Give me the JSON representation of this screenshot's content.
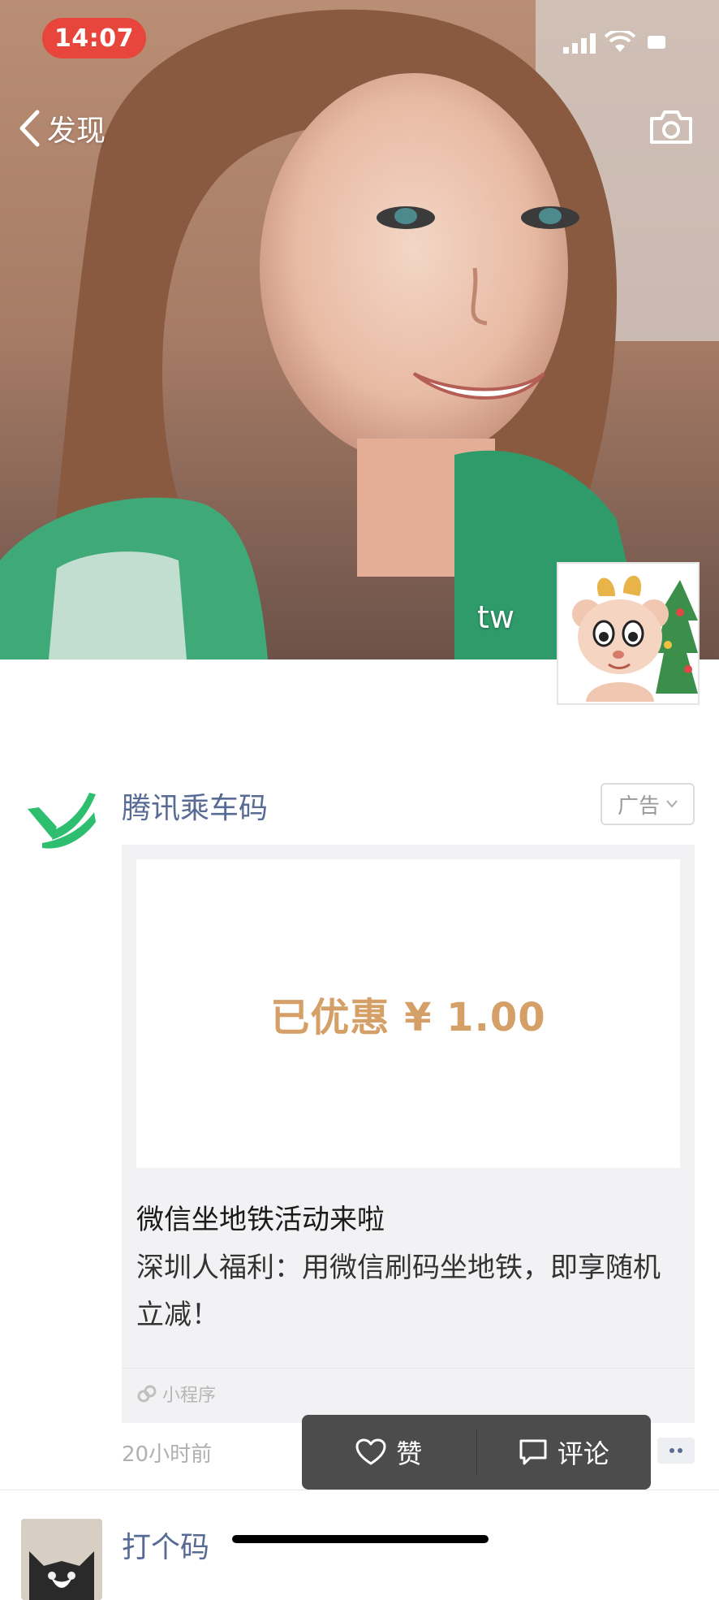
{
  "status_bar": {
    "time": "14:07",
    "time_pill_color": "#e8453c",
    "icons": [
      "signal-icon",
      "wifi-icon",
      "battery-icon"
    ]
  },
  "nav": {
    "back_label": "发现",
    "back_icon": "chevron-left-icon",
    "camera_icon": "camera-icon"
  },
  "cover": {
    "username": "tw",
    "avatar_icon": "cartoon-mouse-christmas-tree-avatar"
  },
  "ad_post": {
    "brand_name": "腾讯乘车码",
    "brand_logo_icon": "tencent-ride-code-logo",
    "brand_logo_color": "#2dbf6f",
    "ad_badge": "广告",
    "discount_text": "已优惠 ¥ 1.00",
    "title": "微信坐地铁活动来啦",
    "description": "深圳人福利：用微信刷码坐地铁，即享随机立减！",
    "mini_program_label": "小程序",
    "time_ago": "20小时前"
  },
  "action_popup": {
    "like_label": "赞",
    "comment_label": "评论"
  },
  "next_post": {
    "name": "打个码"
  },
  "colors": {
    "link_blue": "#576b95",
    "discount_gold": "#d4a068",
    "popup_bg": "#4c4c4c"
  }
}
